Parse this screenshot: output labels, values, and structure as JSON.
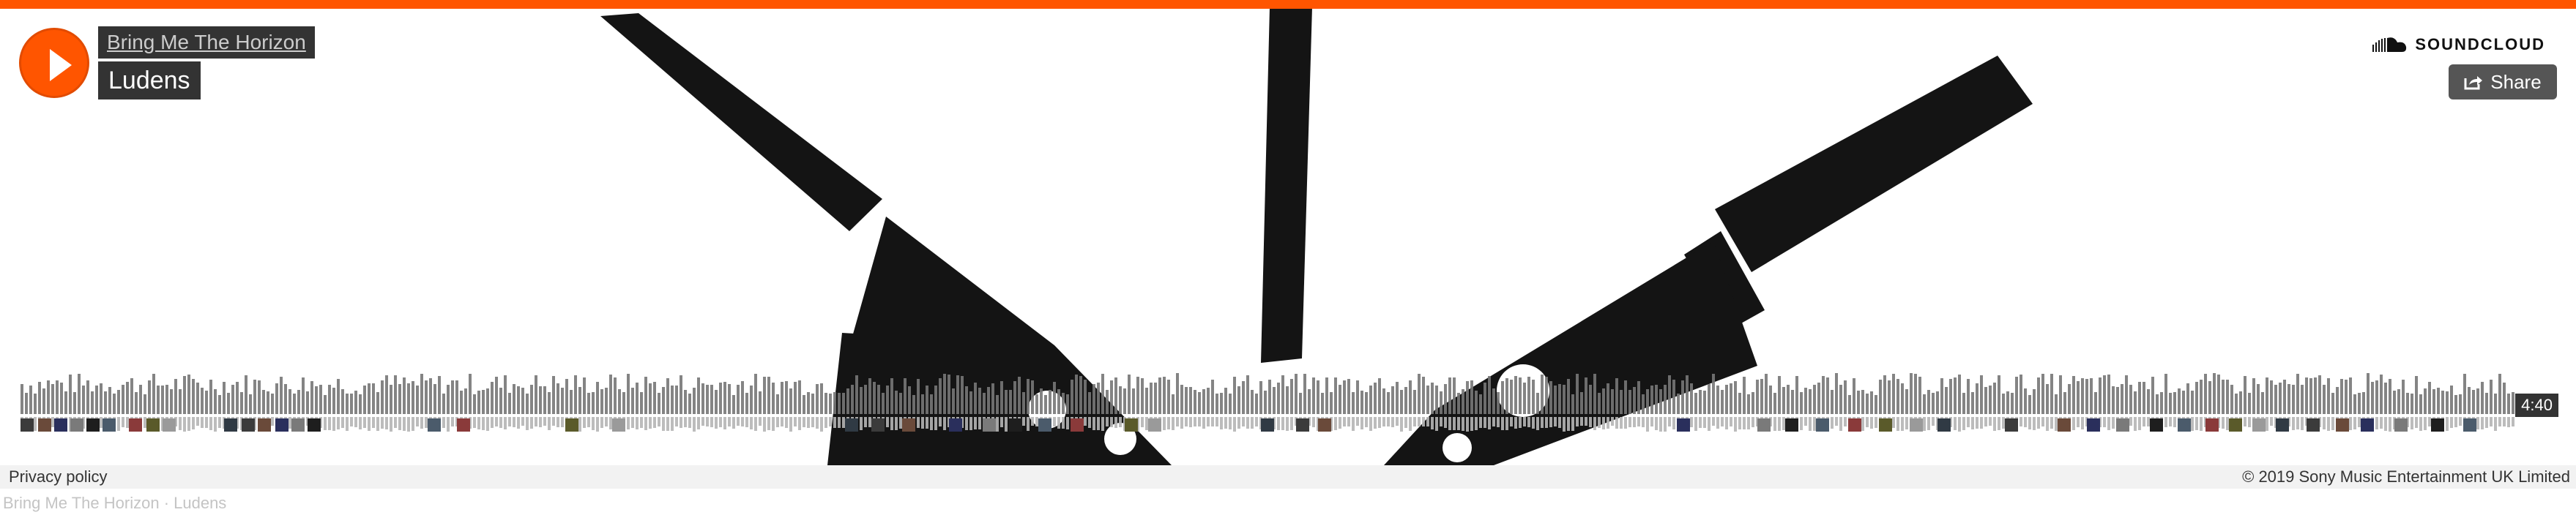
{
  "player": {
    "artist": "Bring Me The Horizon",
    "title": "Ludens",
    "duration": "4:40",
    "brand_logo_text": "SOUNDCLOUD",
    "share_label": "Share",
    "accent_color": "#ff5500"
  },
  "footer": {
    "privacy_label": "Privacy policy",
    "copyright": "© 2019 Sony Music Entertainment UK Limited"
  },
  "caption": "Bring Me The Horizon · Ludens",
  "icons": [
    "play-icon",
    "soundcloud-cloud-icon",
    "share-icon"
  ]
}
